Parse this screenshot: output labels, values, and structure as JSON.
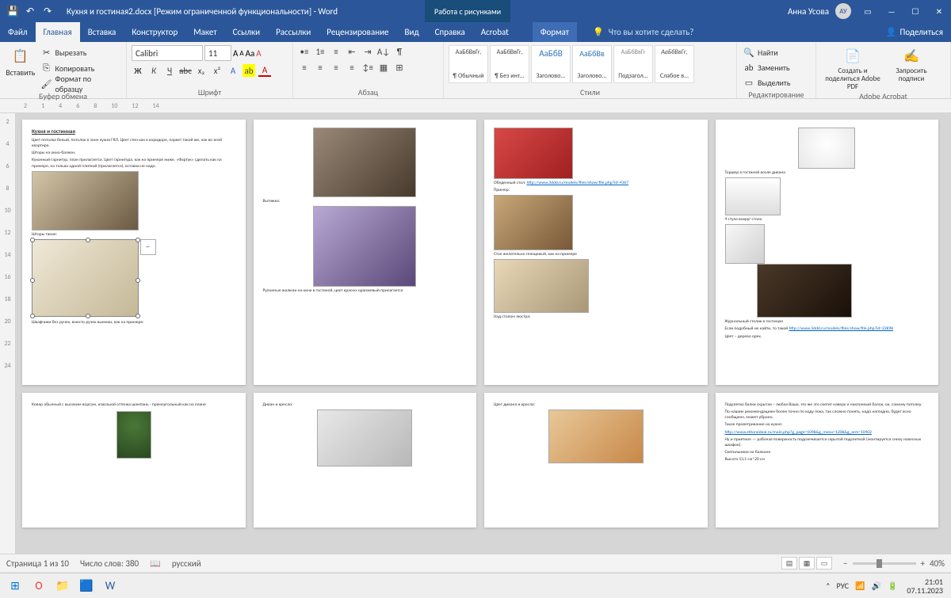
{
  "titlebar": {
    "doc": "Кухня и гостиная2.docx  [Режим ограниченной функциональности]  -  Word",
    "pictools": "Работа с рисунками",
    "user": "Анна Усова",
    "avatar": "АУ"
  },
  "tabs": {
    "file": "Файл",
    "home": "Главная",
    "insert": "Вставка",
    "design": "Конструктор",
    "layout": "Макет",
    "refs": "Ссылки",
    "mail": "Рассылки",
    "review": "Рецензирование",
    "view": "Вид",
    "help": "Справка",
    "acrobat": "Acrobat",
    "format": "Формат",
    "tellme": "Что вы хотите сделать?",
    "share": "Поделиться"
  },
  "ribbon": {
    "paste": "Вставить",
    "cut": "Вырезать",
    "copy": "Копировать",
    "fmtpaint": "Формат по образцу",
    "clipboard": "Буфер обмена",
    "fontname": "Calibri",
    "fontsize": "11",
    "font": "Шрифт",
    "para": "Абзац",
    "styles_lbl": "Стили",
    "styles": [
      {
        "sample": "АаБбВвГг,",
        "name": "¶ Обычный"
      },
      {
        "sample": "АаБбВвГг,",
        "name": "¶ Без инт..."
      },
      {
        "sample": "АаБбВ",
        "name": "Заголово..."
      },
      {
        "sample": "АаБбВв",
        "name": "Заголово..."
      },
      {
        "sample": "АаБбВвГг",
        "name": "Подзагол..."
      },
      {
        "sample": "АаБбВвГг,",
        "name": "Слабое в..."
      }
    ],
    "find": "Найти",
    "replace": "Заменить",
    "select": "Выделить",
    "editing": "Редактирование",
    "adobe1": "Создать и поделиться Adobe PDF",
    "adobe2": "Запросить подписи",
    "adobe_lbl": "Adobe Acrobat"
  },
  "pages": {
    "p1": {
      "h": "Кухня и гостинная",
      "t1": "Цвет потолка белый, потолок в зоне кухни ГКЛ. Цвет стен как в коридоре, паркет такой же, как во всей квартире.",
      "t2": "Шторы на окно-балкон.",
      "t3": "Кухонный гарнитур, план прилагается. Цвет гарнитура, как на примере ниже. «Фартук» сделать как на примере, но только одной плиткой (прилагается), вставки не надо.",
      "t4": "Шторы такие:",
      "t5": "Шкафчики без ручек, вместо ручек выемки, как на примере:"
    },
    "p2": {
      "t1": "Вытяжка:",
      "t2": "Рулонные жалюзи на окна в гостиной, цвет красно-оранжевый прилагается"
    },
    "p3": {
      "t1": "Обеденный стол:",
      "link1": "http://www.3ddd.ru/models/files/show/file.php?id=4367",
      "t2": "Пример:",
      "t3": "Стол желательно глянцевый, как на примере",
      "t4": "Над столом люстра:"
    },
    "p4": {
      "t1": "Торшер в гостиной возле дивана",
      "t2": "4 стула вокруг стола",
      "t3": "Журнальный столик в гостиную",
      "t4": "Если подобный не найти, то такой",
      "link2": "http://www.3ddd.ru/models/files/show/file.php?id=22898",
      "t5": "Цвет – дерево орех."
    },
    "p5": {
      "t1": "Ковер обычный с высоким ворсом, язкозыой оттенка шампань - прямоугольный как на плане"
    },
    "p6": {
      "t1": "Диван и кресло:"
    },
    "p7": {
      "t1": "Цвет дивана и кресла:"
    },
    "p8": {
      "t1": "Подсветка балки скрытая – любая Ваша, это же это светит наверх и наклонный балок, ок, самому потолку.",
      "t2": "По нашим рекомендациям более точно по коду пока, так сложно понять, надо наглядно, будет ясно сообщаем, может убрано.",
      "t3": "Такое проветривание на кухне:",
      "link3": "http://www.shtoraideal.ru/main.php?g_page=1098&g_menu=1208&g_arm=10402",
      "t4": "Ну и приятное — рабочая поверхность подсвечивается скрытой подсветкой (монтируется снизу навесных шкафов).",
      "t5": "Светильники на балконе",
      "t6": "Высота 13,5 см*20 см"
    }
  },
  "status": {
    "page": "Страница 1 из 10",
    "words": "Число слов: 380",
    "lang": "русский",
    "zoom": "40%"
  },
  "tray": {
    "kb": "РУС",
    "time": "21:01",
    "date": "07.11.2023"
  }
}
